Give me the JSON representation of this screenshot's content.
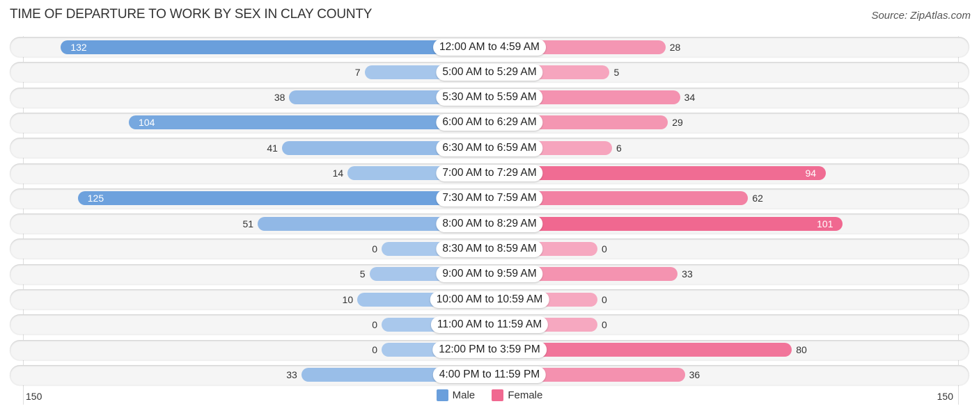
{
  "chart_data": {
    "type": "bar",
    "orientation": "horizontal-diverging",
    "title": "TIME OF DEPARTURE TO WORK BY SEX IN CLAY COUNTY",
    "source": "Source: ZipAtlas.com",
    "categories": [
      "12:00 AM to 4:59 AM",
      "5:00 AM to 5:29 AM",
      "5:30 AM to 5:59 AM",
      "6:00 AM to 6:29 AM",
      "6:30 AM to 6:59 AM",
      "7:00 AM to 7:29 AM",
      "7:30 AM to 7:59 AM",
      "8:00 AM to 8:29 AM",
      "8:30 AM to 8:59 AM",
      "9:00 AM to 9:59 AM",
      "10:00 AM to 10:59 AM",
      "11:00 AM to 11:59 AM",
      "12:00 PM to 3:59 PM",
      "4:00 PM to 11:59 PM"
    ],
    "series": [
      {
        "name": "Male",
        "color": "#6a9fdc",
        "light_color": "#a9c8ec",
        "values": [
          132,
          7,
          38,
          104,
          41,
          14,
          125,
          51,
          0,
          5,
          10,
          0,
          0,
          33
        ]
      },
      {
        "name": "Female",
        "color": "#f06890",
        "light_color": "#f6a8c0",
        "values": [
          28,
          5,
          34,
          29,
          6,
          94,
          62,
          101,
          0,
          33,
          0,
          0,
          80,
          36
        ]
      }
    ],
    "axis": {
      "left_label": "150",
      "right_label": "150",
      "max": 150
    },
    "legend": {
      "position": "bottom-center",
      "items": [
        "Male",
        "Female"
      ]
    }
  }
}
